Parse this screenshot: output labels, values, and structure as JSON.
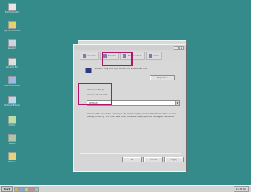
{
  "desktop": {
    "icons": [
      {
        "label": "My Computer",
        "icon": "computer-icon",
        "color": "#e0e0e0"
      },
      {
        "label": "My Documents",
        "icon": "folder-icon",
        "color": "#e3d36a"
      },
      {
        "label": "Network",
        "icon": "network-icon",
        "color": "#c9d6e6"
      },
      {
        "label": "Recycle Bin",
        "icon": "recycle-bin-icon",
        "color": "#d8e0e0"
      },
      {
        "label": "Internet Explorer",
        "icon": "globe-icon",
        "color": "#9cb8e6"
      },
      {
        "label": "Outlook Express",
        "icon": "mail-icon",
        "color": "#b9d9f0"
      },
      {
        "label": "Utility",
        "icon": "tool-icon",
        "color": "#b8e0a8"
      },
      {
        "label": "Setup",
        "icon": "setup-icon",
        "color": "#a8c8a8"
      },
      {
        "label": "Folder",
        "icon": "folder-icon",
        "color": "#e6d277"
      }
    ]
  },
  "dialog": {
    "title_buttons": [
      "?",
      "x"
    ],
    "tabs": [
      {
        "label": "Adapter",
        "icon": "adapter-icon"
      },
      {
        "label": "Monitor",
        "icon": "monitor-icon"
      },
      {
        "label": "Troubleshoot",
        "icon": "wrench-icon"
      },
      {
        "label": "Color",
        "icon": "color-icon"
      }
    ],
    "device_text": "Generic Plug and Play Monitor on NVIDIA GeForce",
    "properties_button": "Properties",
    "group_title": "Monitor settings",
    "refresh_label": "Screen refresh rate:",
    "refresh_value": "60 Hertz",
    "note_text": "Clearing this check box allows you to select display modes that this monitor cannot display correctly. This may lead to an unusable display and/or damaged hardware.",
    "ok": "OK",
    "cancel": "Cancel",
    "apply": "Apply",
    "highlight_color": "#b0176a"
  },
  "taskbar": {
    "start_label": "Start",
    "clock": "10:32 AM"
  }
}
